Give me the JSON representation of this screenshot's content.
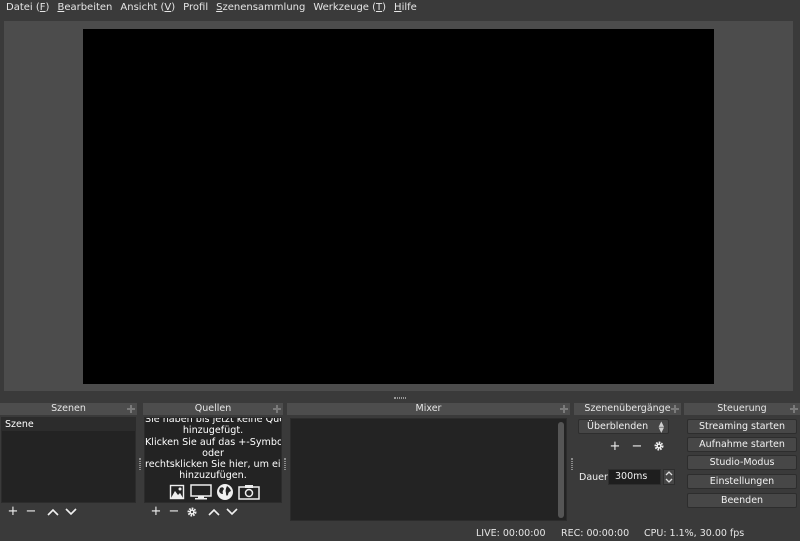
{
  "menu": [
    {
      "pre": "Datei (",
      "key": "F",
      "post": ")"
    },
    {
      "pre": "",
      "key": "B",
      "post": "earbeiten"
    },
    {
      "pre": "Ansicht (",
      "key": "V",
      "post": ")"
    },
    {
      "pre": "Profil",
      "key": "",
      "post": ""
    },
    {
      "pre": "",
      "key": "S",
      "post": "zenensammlung"
    },
    {
      "pre": "Werkzeuge (",
      "key": "T",
      "post": ")"
    },
    {
      "pre": "",
      "key": "H",
      "post": "ilfe"
    }
  ],
  "colors": {
    "background": "#3a3a3a",
    "preview_bg": "#4c4c4c",
    "canvas": "#000000",
    "dock_title": "#4d4d4d",
    "list_bg": "#232323"
  },
  "docks": {
    "scenes": {
      "title": "Szenen",
      "items": [
        "Szene"
      ]
    },
    "sources": {
      "title": "Quellen",
      "empty_lines": [
        "Sie haben bis jetzt keine Quellen",
        "hinzugefügt.",
        "Klicken Sie auf das +-Symbol",
        "oder",
        "rechtsklicken Sie hier, um eine",
        "hinzuzufügen."
      ]
    },
    "mixer": {
      "title": "Mixer"
    },
    "transitions": {
      "title": "Szenenübergänge",
      "selected": "Überblenden",
      "duration_label": "Dauer",
      "duration_value": "300ms"
    },
    "controls": {
      "title": "Steuerung",
      "buttons": [
        "Streaming starten",
        "Aufnahme starten",
        "Studio-Modus",
        "Einstellungen",
        "Beenden"
      ]
    }
  },
  "toolbar_glyphs": {
    "add": "+",
    "remove": "−",
    "up": "︿",
    "down": "﹀"
  },
  "icons": {
    "gear": "gear-icon",
    "image": "image-source-icon",
    "display": "display-capture-icon",
    "browser": "browser-source-icon",
    "camera": "camera-source-icon"
  },
  "status": {
    "live": "LIVE: 00:00:00",
    "rec": "REC: 00:00:00",
    "cpu": "CPU: 1.1%, 30.00 fps"
  }
}
